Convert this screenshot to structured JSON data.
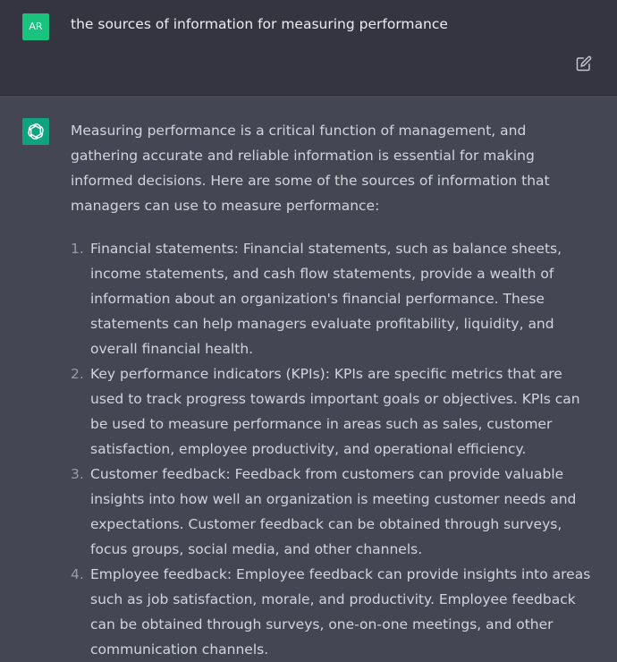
{
  "user": {
    "avatar_initials": "AR",
    "avatar_color": "#19c37d",
    "message": "the sources of information for measuring performance",
    "edit_icon": "edit-icon"
  },
  "assistant": {
    "avatar_icon": "openai-logo-icon",
    "avatar_color": "#10a37f",
    "intro": "Measuring performance is a critical function of management, and gathering accurate and reliable information is essential for making informed decisions. Here are some of the sources of information that managers can use to measure performance:",
    "points": [
      {
        "number": "1.",
        "text": "Financial statements: Financial statements, such as balance sheets, income statements, and cash flow statements, provide a wealth of information about an organization's financial performance. These statements can help managers evaluate profitability, liquidity, and overall financial health."
      },
      {
        "number": "2.",
        "text": "Key performance indicators (KPIs): KPIs are specific metrics that are used to track progress towards important goals or objectives. KPIs can be used to measure performance in areas such as sales, customer satisfaction, employee productivity, and operational efficiency."
      },
      {
        "number": "3.",
        "text": "Customer feedback: Feedback from customers can provide valuable insights into how well an organization is meeting customer needs and expectations. Customer feedback can be obtained through surveys, focus groups, social media, and other channels."
      },
      {
        "number": "4.",
        "text": "Employee feedback: Employee feedback can provide insights into areas such as job satisfaction, morale, and productivity. Employee feedback can be obtained through surveys, one-on-one meetings, and other communication channels."
      }
    ]
  }
}
